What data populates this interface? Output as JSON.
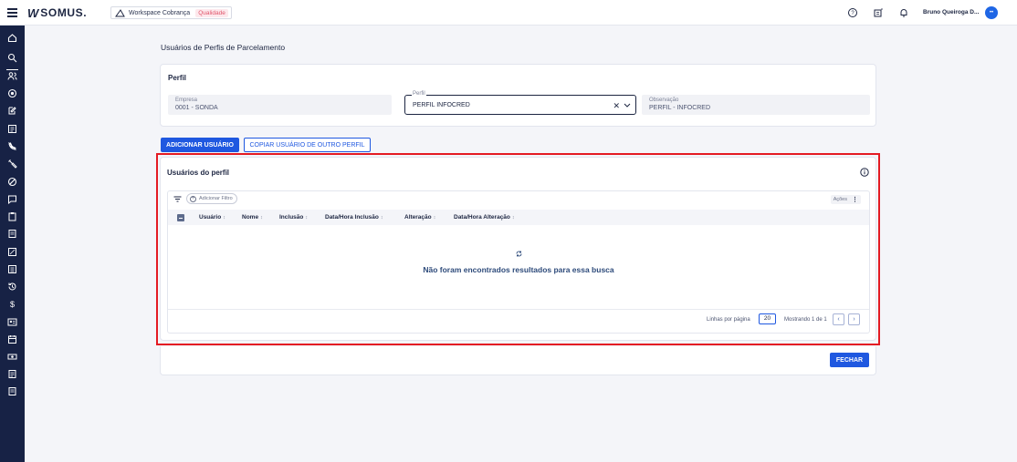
{
  "app": {
    "logo_mark": "W",
    "logo_text": "SOMUS."
  },
  "workspace": {
    "label": "Workspace Cobrança",
    "badge": "Qualidade"
  },
  "user": {
    "name": "Bruno Queiroga D...",
    "avatar_initials": ""
  },
  "sidebar": {
    "icons": [
      "home-icon",
      "search-icon",
      "users-icon",
      "target-icon",
      "edit-icon",
      "board-icon",
      "no-phone-icon",
      "tools-icon",
      "ban-icon",
      "message-icon",
      "clipboard-icon",
      "document-icon",
      "id-card-icon",
      "screen-icon",
      "list-icon",
      "history-icon",
      "dollar-icon",
      "contact-card-icon",
      "calendar-icon",
      "money-icon",
      "report-icon",
      "report2-icon"
    ]
  },
  "page": {
    "title": "Usuários de Perfis de Parcelamento"
  },
  "perfil_card": {
    "title": "Perfil",
    "empresa": {
      "label": "Empresa",
      "value": "0001 - SONDA"
    },
    "perfil": {
      "label": "Perfil",
      "value": "PERFIL INFOCRED"
    },
    "observacao": {
      "label": "Observação",
      "value": "PERFIL - INFOCRED"
    }
  },
  "actions": {
    "add_user": "ADICIONAR USUÁRIO",
    "copy_user": "COPIAR USUÁRIO DE OUTRO PERFIL"
  },
  "users_card": {
    "title": "Usuários do perfil",
    "add_filter": "Adicionar Filtro",
    "acoes": "Ações",
    "columns": [
      "Usuário",
      "Nome",
      "Inclusão",
      "Data/Hora Inclusão",
      "Alteração",
      "Data/Hora Alteração"
    ],
    "empty_message": "Não foram encontrados resultados para essa busca",
    "rows_per_page_label": "Linhas por página",
    "rows_per_page": "20",
    "showing": "Mostrando 1 de 1"
  },
  "footer": {
    "close": "FECHAR"
  },
  "colors": {
    "primary": "#1f58e0",
    "sidebar": "#172245",
    "highlight": "#e41b23"
  }
}
